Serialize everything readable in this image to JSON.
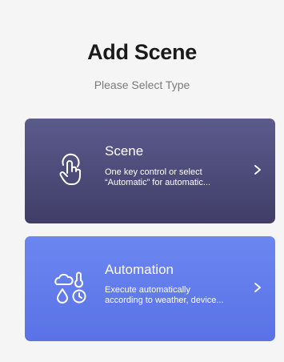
{
  "header": {
    "title": "Add Scene",
    "subtitle": "Please Select Type"
  },
  "cards": [
    {
      "title": "Scene",
      "description_line1": "One key control or select",
      "description_line2": "“Automatic” for automatic...",
      "icon": "tap-hand-icon",
      "color": "#4b4a78"
    },
    {
      "title": "Automation",
      "description_line1": "Execute automatically",
      "description_line2": "according to weather, device...",
      "icon": "weather-time-icon",
      "color": "#6179ec"
    }
  ]
}
